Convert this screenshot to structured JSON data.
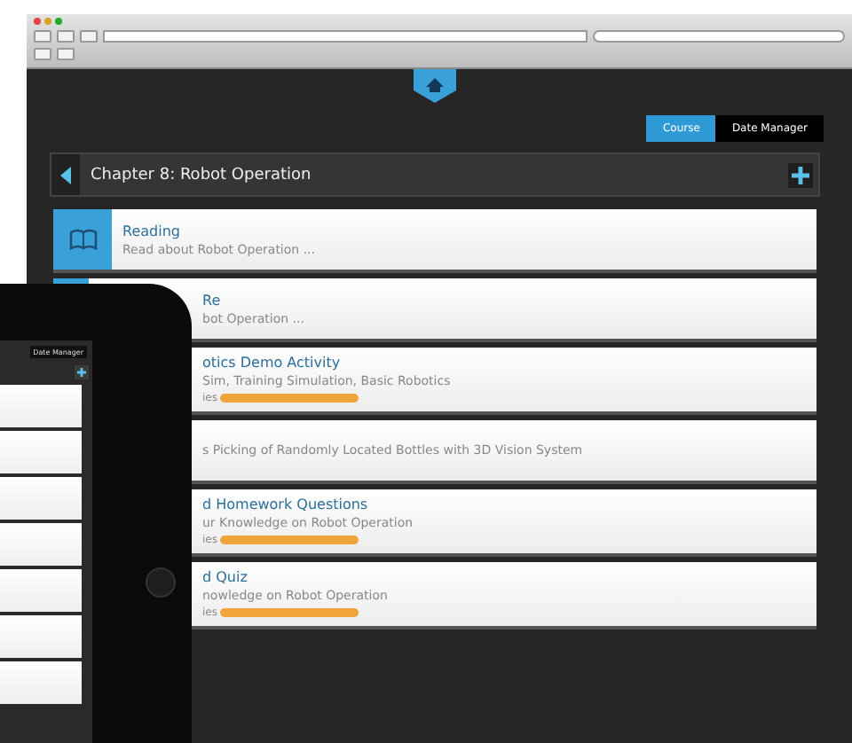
{
  "tabs": [
    {
      "label": "Course",
      "selected": true
    },
    {
      "label": "Date Manager",
      "selected": false
    }
  ],
  "header": {
    "title": "Chapter 8: Robot Operation"
  },
  "lessons": [
    {
      "kind": "full",
      "title": "Reading",
      "subtitle": "Read about Robot Operation ..."
    },
    {
      "kind": "clipped",
      "title": "Re",
      "subtitle": "bot Operation ..."
    },
    {
      "kind": "clipped",
      "title": "otics Demo Activity",
      "subtitle": "Sim, Training Simulation, Basic Robotics",
      "meta": "ies"
    },
    {
      "kind": "clipped",
      "subtitle": "s Picking of Randomly Located Bottles with 3D Vision System"
    },
    {
      "kind": "clipped",
      "title": "d Homework Questions",
      "subtitle": "ur Knowledge on Robot Operation",
      "meta": "ies"
    },
    {
      "kind": "clipped",
      "title": "d Quiz",
      "subtitle": "nowledge on Robot Operation",
      "meta": "ies"
    }
  ],
  "tablet": {
    "tab_label": "Date Manager"
  }
}
